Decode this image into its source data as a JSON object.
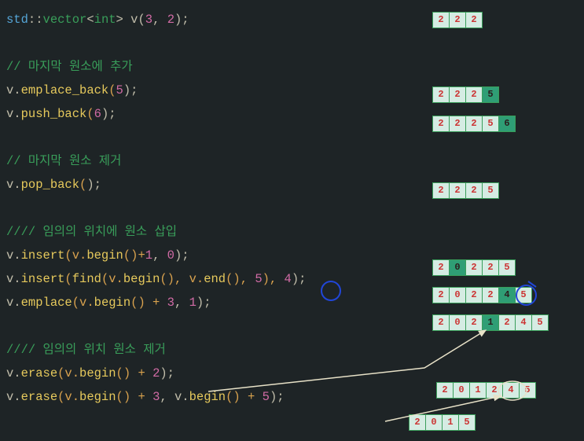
{
  "lines": {
    "l1_std": "std",
    "l1_dcolon": "::",
    "l1_vector": "vector",
    "l1_lt": "<",
    "l1_int": "int",
    "l1_gt": ">",
    "l1_rest": " v(",
    "l1_n1": "3",
    "l1_comma": ", ",
    "l1_n2": "2",
    "l1_end": ");",
    "c1": "// 마지막 원소에 추가",
    "l2a": "v.",
    "l2fn": "emplace_back",
    "l2p": "(",
    "l2n": "5",
    "l2e": ");",
    "l3a": "v.",
    "l3fn": "push_back",
    "l3p": "(",
    "l3n": "6",
    "l3e": ");",
    "c2": "// 마지막 원소 제거",
    "l4a": "v.",
    "l4fn": "pop_back",
    "l4p": "(",
    "l4e": ");",
    "c3": "//// 임의의 위치에 원소 삽입",
    "l5a": "v.",
    "l5fn": "insert",
    "l5p": "(v.",
    "l5fn2": "begin",
    "l5p2": "()+",
    "l5n1": "1",
    "l5c": ", ",
    "l5n2": "0",
    "l5e": ");",
    "l6a": "v.",
    "l6fn": "insert",
    "l6p": "(",
    "l6fn2": "find",
    "l6p2": "(v.",
    "l6fn3": "begin",
    "l6p3": "(), v.",
    "l6fn4": "end",
    "l6p4": "(), ",
    "l6n1": "5",
    "l6p5": "), ",
    "l6n2": "4",
    "l6e": ");",
    "l7a": "v.",
    "l7fn": "emplace",
    "l7p": "(v.",
    "l7fn2": "begin",
    "l7p2": "() + ",
    "l7n1": "3",
    "l7c": ", ",
    "l7n2": "1",
    "l7e": ");",
    "c4": "//// 임의의 위치 원소 제거",
    "l8a": "v.",
    "l8fn": "erase",
    "l8p": "(v.",
    "l8fn2": "begin",
    "l8p2": "() + ",
    "l8n": "2",
    "l8e": ");",
    "l9a": "v.",
    "l9fn": "erase",
    "l9p": "(v.",
    "l9fn2": "begin",
    "l9p2": "() + ",
    "l9n1": "3",
    "l9c": ", v.",
    "l9fn3": "begin",
    "l9p3": "() + ",
    "l9n2": "5",
    "l9e": ");"
  },
  "vectors": {
    "v1": [
      {
        "v": "2"
      },
      {
        "v": "2"
      },
      {
        "v": "2"
      }
    ],
    "v2": [
      {
        "v": "2"
      },
      {
        "v": "2"
      },
      {
        "v": "2"
      },
      {
        "v": "5",
        "hl": true
      }
    ],
    "v3": [
      {
        "v": "2"
      },
      {
        "v": "2"
      },
      {
        "v": "2"
      },
      {
        "v": "5"
      },
      {
        "v": "6",
        "hl": true
      }
    ],
    "v4": [
      {
        "v": "2"
      },
      {
        "v": "2"
      },
      {
        "v": "2"
      },
      {
        "v": "5"
      }
    ],
    "v5": [
      {
        "v": "2"
      },
      {
        "v": "0",
        "hl": true
      },
      {
        "v": "2"
      },
      {
        "v": "2"
      },
      {
        "v": "5"
      }
    ],
    "v6": [
      {
        "v": "2"
      },
      {
        "v": "0"
      },
      {
        "v": "2"
      },
      {
        "v": "2"
      },
      {
        "v": "4",
        "hl": true
      },
      {
        "v": "5"
      }
    ],
    "v7": [
      {
        "v": "2"
      },
      {
        "v": "0"
      },
      {
        "v": "2"
      },
      {
        "v": "1",
        "hl": true
      },
      {
        "v": "2"
      },
      {
        "v": "4"
      },
      {
        "v": "5"
      }
    ],
    "v8": [
      {
        "v": "2"
      },
      {
        "v": "0"
      },
      {
        "v": "1"
      },
      {
        "v": "2"
      },
      {
        "v": "4"
      },
      {
        "v": "5"
      }
    ],
    "v9": [
      {
        "v": "2"
      },
      {
        "v": "0"
      },
      {
        "v": "1"
      },
      {
        "v": "5"
      }
    ]
  }
}
